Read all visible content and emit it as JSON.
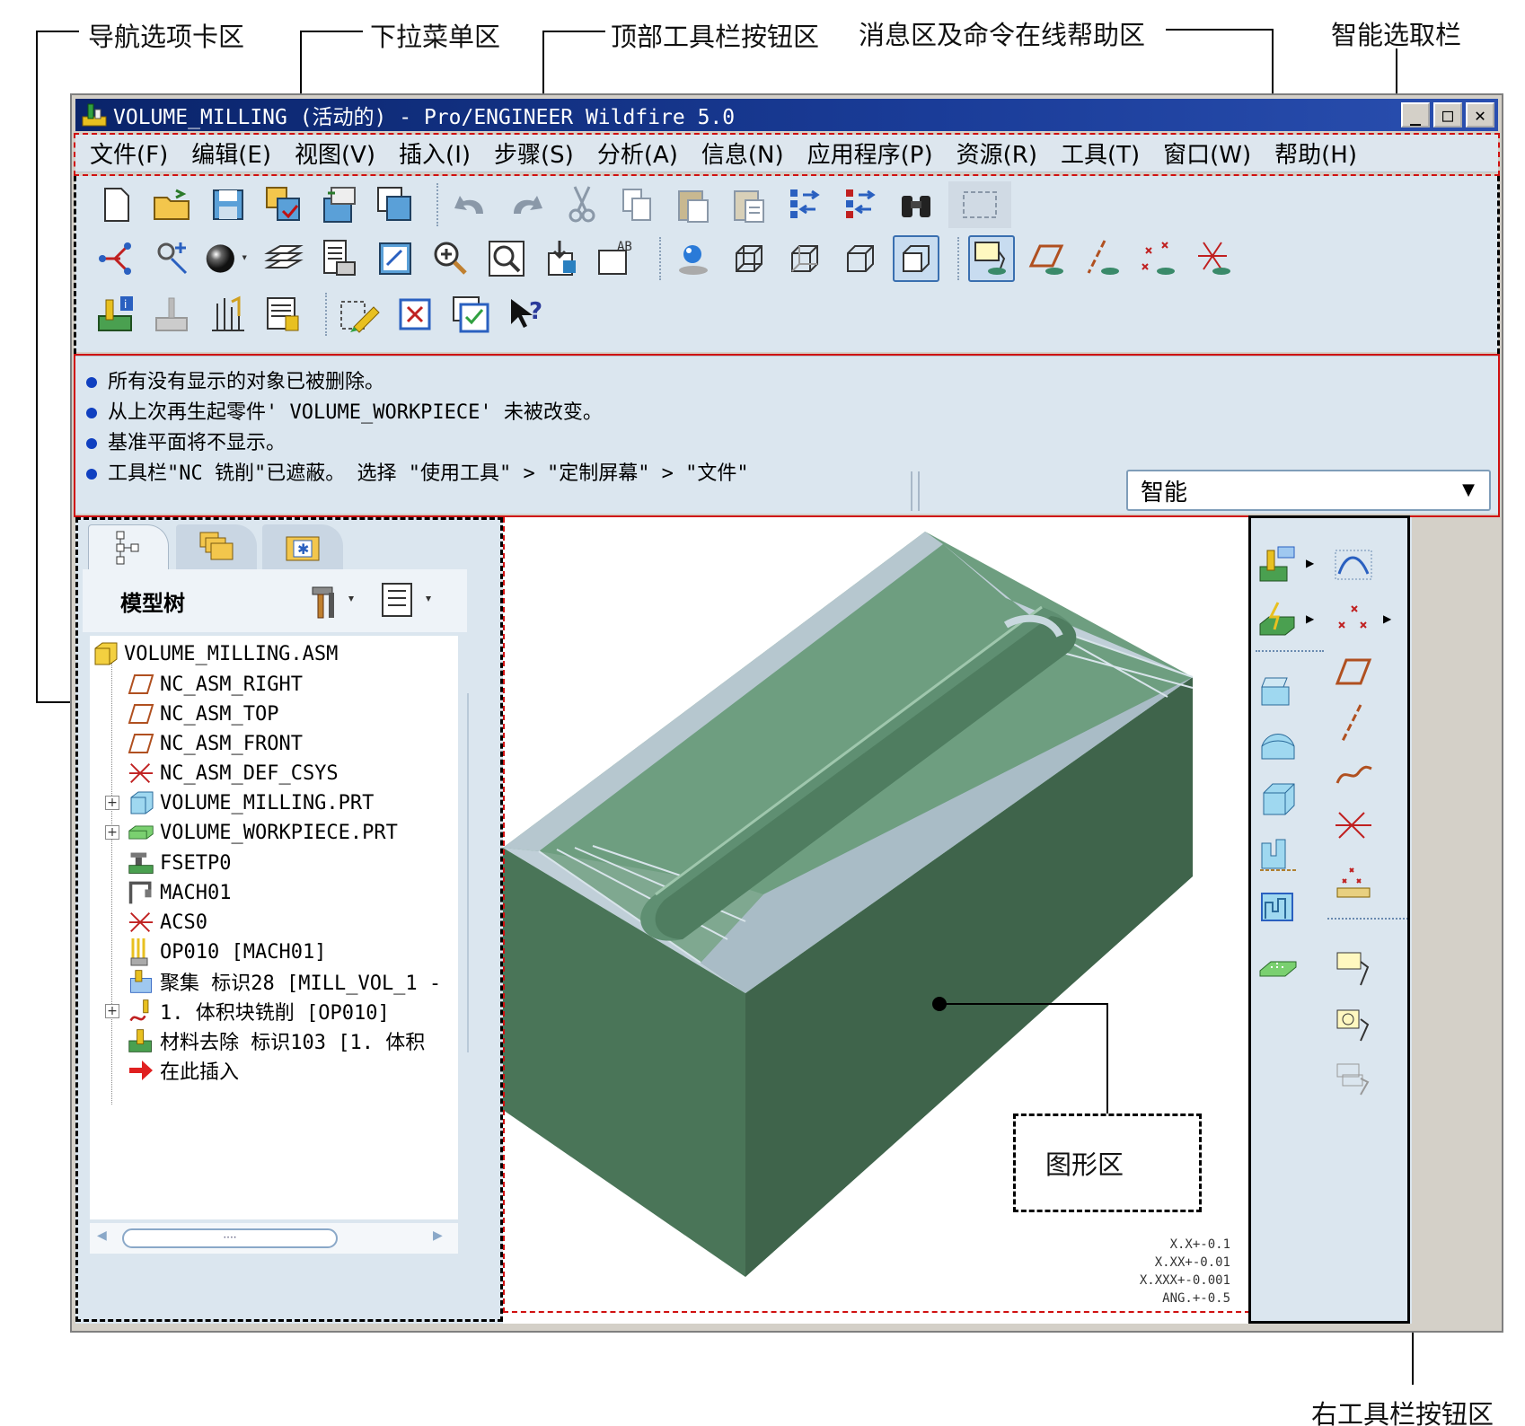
{
  "annotations": {
    "nav_tab_area": "导航选项卡区",
    "dropdown_menu_area": "下拉菜单区",
    "top_toolbar_area": "顶部工具栏按钮区",
    "message_help_area": "消息区及命令在线帮助区",
    "smart_select_bar": "智能选取栏",
    "graphics_area": "图形区",
    "right_toolbar_area": "右工具栏按钮区"
  },
  "window": {
    "title": "VOLUME_MILLING (活动的) - Pro/ENGINEER Wildfire 5.0",
    "minimize": "_",
    "maximize": "□",
    "close": "✕"
  },
  "menubar": {
    "items": [
      "文件(F)",
      "编辑(E)",
      "视图(V)",
      "插入(I)",
      "步骤(S)",
      "分析(A)",
      "信息(N)",
      "应用程序(P)",
      "资源(R)",
      "工具(T)",
      "窗口(W)",
      "帮助(H)"
    ]
  },
  "toolbar": {
    "row1": [
      "new-file-icon",
      "open-folder-icon",
      "save-icon",
      "save-copy-icon",
      "backup-icon",
      "rename-icon",
      "undo-icon",
      "redo-icon",
      "cut-icon",
      "copy-icon",
      "paste-icon",
      "paste-special-icon",
      "regenerate-icon",
      "regen-manager-icon",
      "find-icon",
      "select-box-icon"
    ],
    "row2": [
      "spin-center-icon",
      "orient-icon",
      "appearance-icon",
      "layers-icon",
      "view-manager-icon",
      "repaint-icon",
      "zoom-in-icon",
      "zoom-fit-icon",
      "refit-icon",
      "annotation-icon",
      "light-icon",
      "wireframe-icon",
      "hidden-line-icon",
      "no-hidden-icon",
      "shading-icon",
      "datum-plane-display-icon",
      "datum-axis-display-icon",
      "point-display-icon",
      "csys-display-icon"
    ],
    "row3": [
      "manufacture-info-icon",
      "nc-sequence-icon",
      "tool-path-icon",
      "process-manager-icon",
      "edit-icon",
      "close-window-icon",
      "activate-window-icon",
      "context-help-icon"
    ]
  },
  "messages": [
    "所有没有显示的对象已被删除。",
    "从上次再生起零件' VOLUME_WORKPIECE' 未被改变。",
    "基准平面将不显示。",
    "工具栏\"NC 铣削\"已遮蔽。   选择 \"使用工具\" > \"定制屏幕\"  > \"文件\""
  ],
  "smart_select": {
    "value": "智能"
  },
  "nav_panel": {
    "tree_title": "模型树",
    "tree_items": [
      "VOLUME_MILLING.ASM",
      "NC_ASM_RIGHT",
      "NC_ASM_TOP",
      "NC_ASM_FRONT",
      "NC_ASM_DEF_CSYS",
      "VOLUME_MILLING.PRT",
      "VOLUME_WORKPIECE.PRT",
      "FSETP0",
      "MACH01",
      "ACS0",
      "OP010 [MACH01]",
      "聚集 标识28 [MILL_VOL_1 -",
      "1. 体积块铣削 [OP010]",
      "材料去除 标识103 [1. 体积",
      "在此插入"
    ],
    "scroll_thumb": "····"
  },
  "graphics": {
    "tolerance_lines": [
      "X.X+-0.1",
      "X.XX+-0.01",
      "X.XXX+-0.001",
      "ANG.+-0.5"
    ]
  },
  "colors": {
    "part_top": "#6f9f82",
    "part_side_light": "#5e8a6c",
    "part_side_dark": "#3e6248",
    "chamfer_face": "#c0cfd8",
    "panel_bg": "#dbe6ef",
    "annotation_red": "#d01010"
  }
}
